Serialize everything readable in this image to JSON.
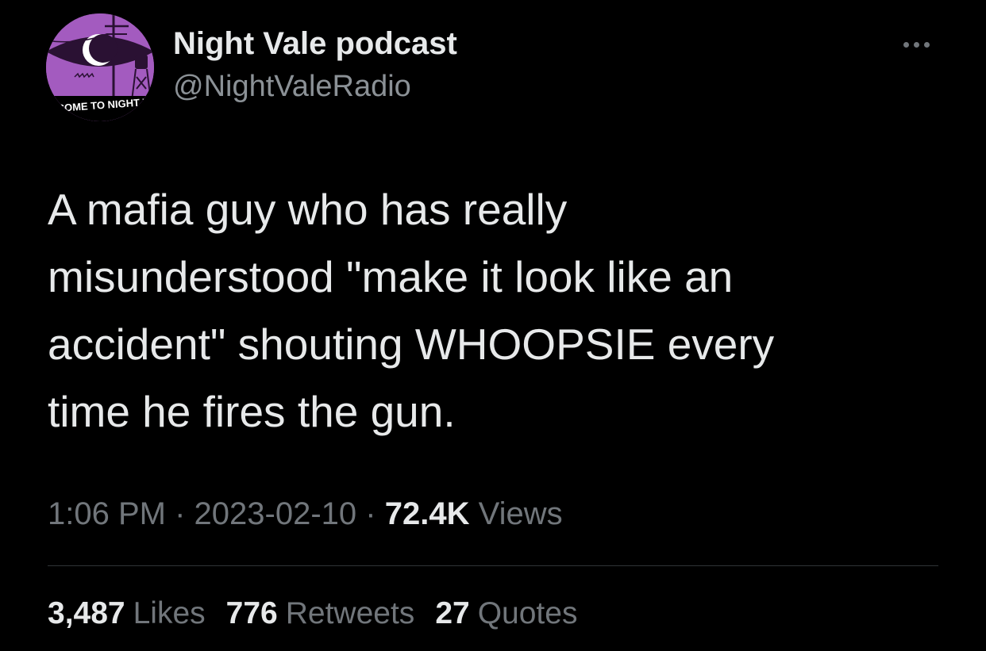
{
  "author": {
    "display_name": "Night Vale podcast",
    "handle": "@NightValeRadio",
    "avatar_caption": "COME TO NIGHT VALE"
  },
  "tweet": {
    "lines": [
      "A mafia guy who has really",
      "misunderstood \"make it look like an",
      "accident\" shouting WHOOPSIE every",
      "time he fires the gun."
    ],
    "time": "1:06 PM",
    "separator": "·",
    "date": "2023-02-10",
    "views_count": "72.4K",
    "views_label": "Views"
  },
  "stats": {
    "likes_count": "3,487",
    "likes_label": "Likes",
    "retweets_count": "776",
    "retweets_label": "Retweets",
    "quotes_count": "27",
    "quotes_label": "Quotes"
  },
  "colors": {
    "background": "#000000",
    "primary_text": "#e7e9ea",
    "secondary_text": "#71767b",
    "avatar_bg": "#a35bbf",
    "divider": "#2f3336"
  },
  "icons": {
    "more": "more-dots-icon",
    "avatar_logo": "night-vale-eye-moon-logo"
  }
}
